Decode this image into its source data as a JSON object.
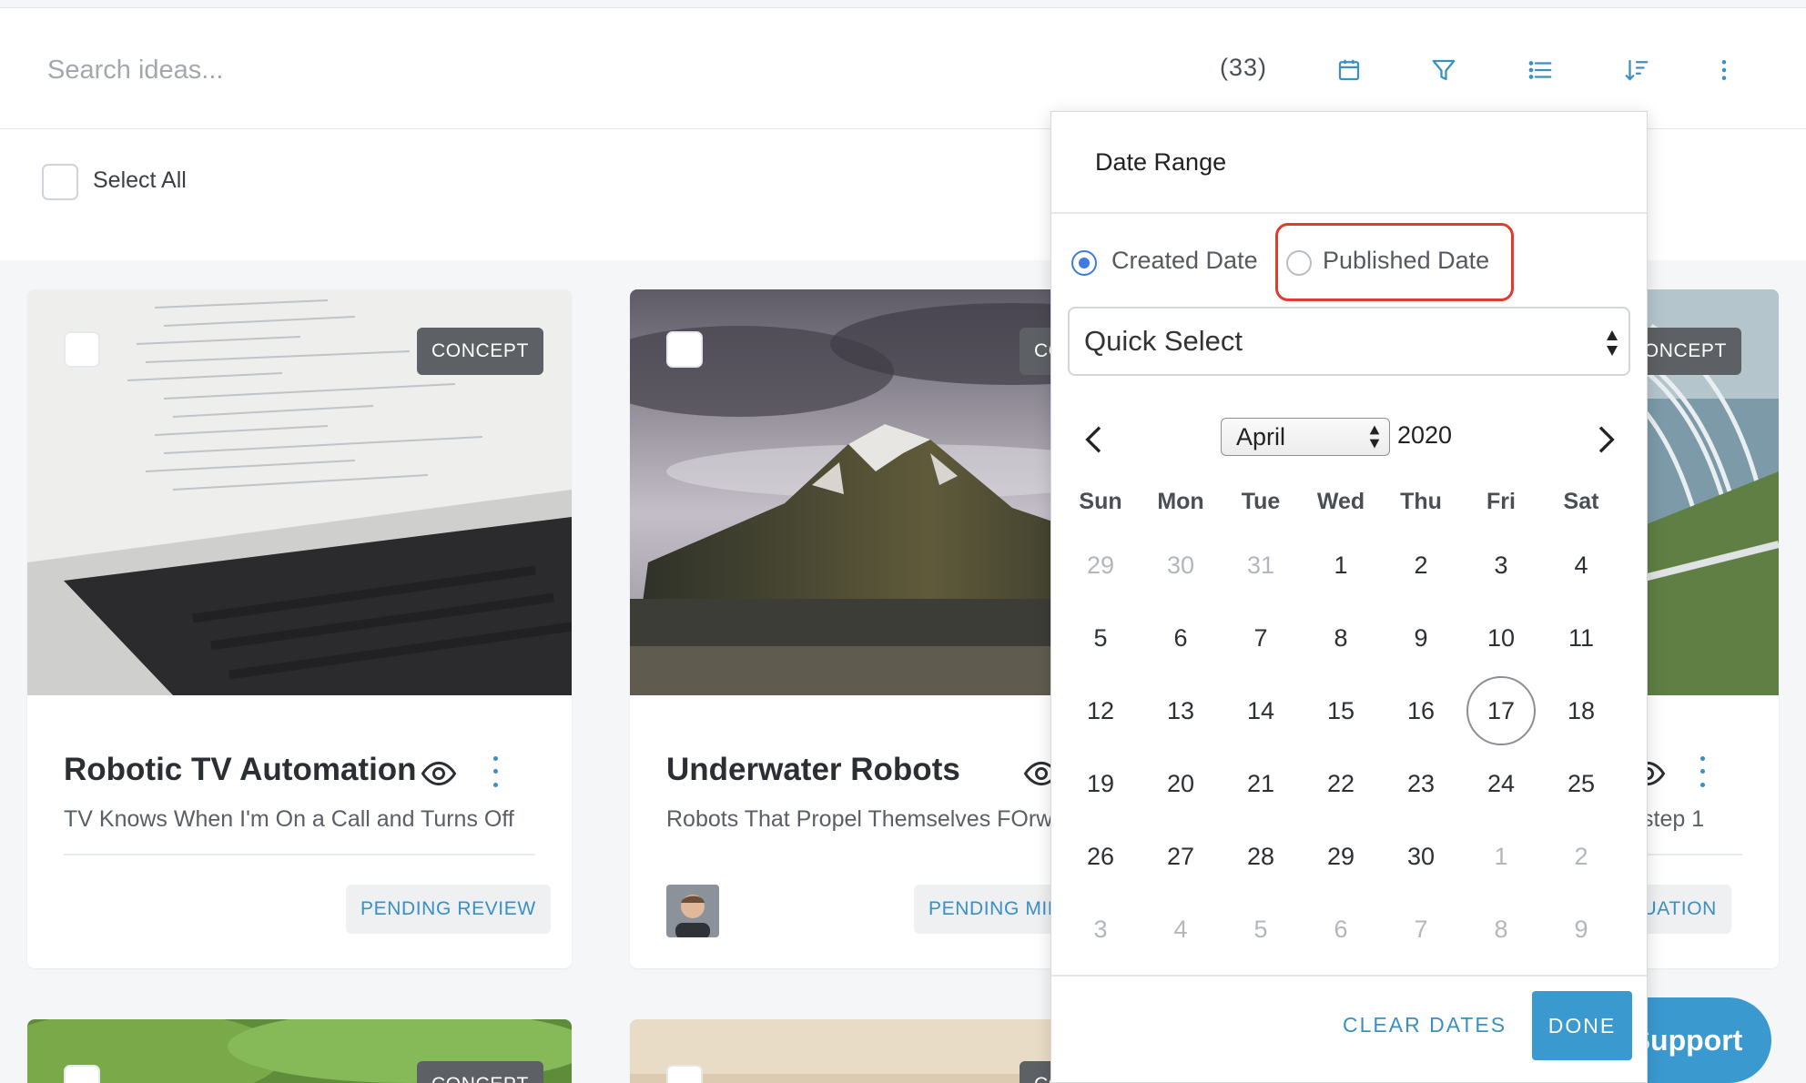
{
  "search": {
    "placeholder": "Search ideas...",
    "count": "(33)"
  },
  "toolbar": {
    "icons": [
      "calendar-icon",
      "filter-icon",
      "list-view-icon",
      "sort-icon",
      "more-vertical-icon"
    ]
  },
  "select_all": {
    "label": "Select All"
  },
  "cards": [
    {
      "tag": "CONCEPT",
      "title": "Robotic TV Automation",
      "subtitle": "TV Knows When I'm On a Call and Turns Off",
      "status": "PENDING REVIEW"
    },
    {
      "tag": "CONCEPT",
      "title": "Underwater Robots",
      "subtitle": "Robots That Propel Themselves FOrward",
      "status": "PENDING MILESTONE"
    },
    {
      "tag": "CONCEPT",
      "title": "",
      "subtitle": "step 1",
      "status": "EVALUATION"
    }
  ],
  "bottom_cards": [
    {
      "tag": "CONCEPT"
    },
    {
      "tag": "CONCEPT"
    }
  ],
  "date_range": {
    "title": "Date Range",
    "options": [
      {
        "label": "Created Date",
        "selected": true
      },
      {
        "label": "Published Date",
        "selected": false
      }
    ],
    "quick_select": "Quick Select",
    "month": "April",
    "year": "2020",
    "weekdays": [
      "Sun",
      "Mon",
      "Tue",
      "Wed",
      "Thu",
      "Fri",
      "Sat"
    ],
    "weeks": [
      [
        "29",
        "30",
        "31",
        "1",
        "2",
        "3",
        "4"
      ],
      [
        "5",
        "6",
        "7",
        "8",
        "9",
        "10",
        "11"
      ],
      [
        "12",
        "13",
        "14",
        "15",
        "16",
        "17",
        "18"
      ],
      [
        "19",
        "20",
        "21",
        "22",
        "23",
        "24",
        "25"
      ],
      [
        "26",
        "27",
        "28",
        "29",
        "30",
        "1",
        "2"
      ],
      [
        "3",
        "4",
        "5",
        "6",
        "7",
        "8",
        "9"
      ]
    ],
    "today": "17",
    "clear_label": "CLEAR DATES",
    "done_label": "DONE"
  },
  "support": {
    "label": "Support"
  },
  "colors": {
    "accent": "#3a9ad0",
    "link": "#3a8fc3",
    "highlight": "#e03b2d",
    "radio": "#3d7be0"
  }
}
